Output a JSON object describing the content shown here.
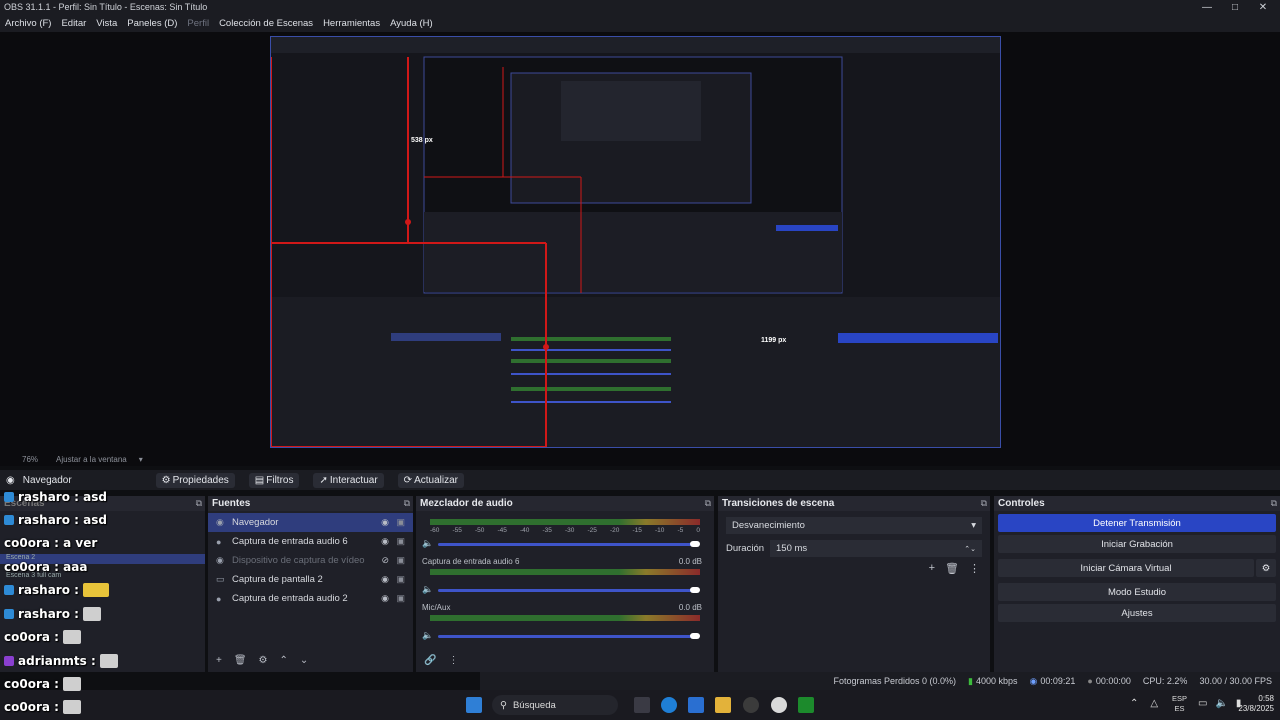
{
  "window": {
    "title": "OBS 31.1.1 - Perfil: Sin Título - Escenas: Sin Título"
  },
  "menu": [
    "Archivo (F)",
    "Editar",
    "Vista",
    "Paneles (D)",
    "Perfil",
    "Colección de Escenas",
    "Herramientas",
    "Ayuda (H)"
  ],
  "zoom": {
    "level": "76%",
    "fit": "Ajustar a la ventana"
  },
  "source_toolbar": {
    "source": "Navegador",
    "properties": "Propiedades",
    "filters": "Filtros",
    "interact": "Interactuar",
    "refresh": "Actualizar"
  },
  "chat": [
    {
      "user": "rasharo",
      "text": ": asd",
      "badge": true,
      "emote": ""
    },
    {
      "user": "rasharo",
      "text": ": asd",
      "badge": true,
      "emote": ""
    },
    {
      "user": "co0ora",
      "text": ": a ver",
      "badge": false,
      "emote": ""
    },
    {
      "user": "co0ora",
      "text": ": aaa",
      "badge": false,
      "emote": ""
    },
    {
      "user": "rasharo",
      "text": ":",
      "badge": true,
      "emote": "yellow"
    },
    {
      "user": "rasharo",
      "text": ":",
      "badge": true,
      "emote": "gray"
    },
    {
      "user": "co0ora",
      "text": ":",
      "badge": false,
      "emote": "gray"
    },
    {
      "user": "adrianmts",
      "text": ":",
      "badge": false,
      "emote": "gray"
    },
    {
      "user": "co0ora",
      "text": ":",
      "badge": false,
      "emote": "gray"
    },
    {
      "user": "co0ora",
      "text": ":",
      "badge": false,
      "emote": "gray"
    }
  ],
  "scenes": {
    "title": "Escenas",
    "items": [
      "Escena 2",
      "Escena 3 full cam"
    ]
  },
  "sources": {
    "title": "Fuentes",
    "items": [
      {
        "name": "Navegador",
        "selected": true,
        "disabled": false
      },
      {
        "name": "Captura de entrada audio 6",
        "selected": false,
        "disabled": false
      },
      {
        "name": "Dispositivo de captura de vídeo",
        "selected": false,
        "disabled": true
      },
      {
        "name": "Captura de pantalla 2",
        "selected": false,
        "disabled": false
      },
      {
        "name": "Captura de entrada audio 2",
        "selected": false,
        "disabled": false
      }
    ]
  },
  "mixer": {
    "title": "Mezclador de audio",
    "ticks": [
      "-60",
      "-55",
      "-50",
      "-45",
      "-40",
      "-35",
      "-30",
      "-25",
      "-20",
      "-15",
      "-10",
      "-5",
      "0"
    ],
    "channels": [
      {
        "name": "",
        "db": "",
        "level": 0.9
      },
      {
        "name": "Captura de entrada audio 6",
        "db": "0.0 dB",
        "level": 0.9
      },
      {
        "name": "Mic/Aux",
        "db": "0.0 dB",
        "level": 0.9
      }
    ]
  },
  "transitions": {
    "title": "Transiciones de escena",
    "selected": "Desvanecimiento",
    "duration_label": "Duración",
    "duration": "150 ms"
  },
  "controls": {
    "title": "Controles",
    "buttons": [
      "Detener Transmisión",
      "Iniciar Grabación",
      "Iniciar Cámara Virtual",
      "Modo Estudio",
      "Ajustes"
    ]
  },
  "status": {
    "dropped": "Fotogramas Perdidos 0 (0.0%)",
    "bitrate": "4000 kbps",
    "stream_time": "00:09:21",
    "rec_time": "00:00:00",
    "cpu": "CPU: 2.2%",
    "fps": "30.00 / 30.00 FPS"
  },
  "taskbar": {
    "search": "Búsqueda",
    "lang": "ESP",
    "lang2": "ES",
    "time": "0:58",
    "date": "23/8/2025"
  },
  "preview": {
    "dim1": "538 px",
    "dim2": "1199 px"
  }
}
